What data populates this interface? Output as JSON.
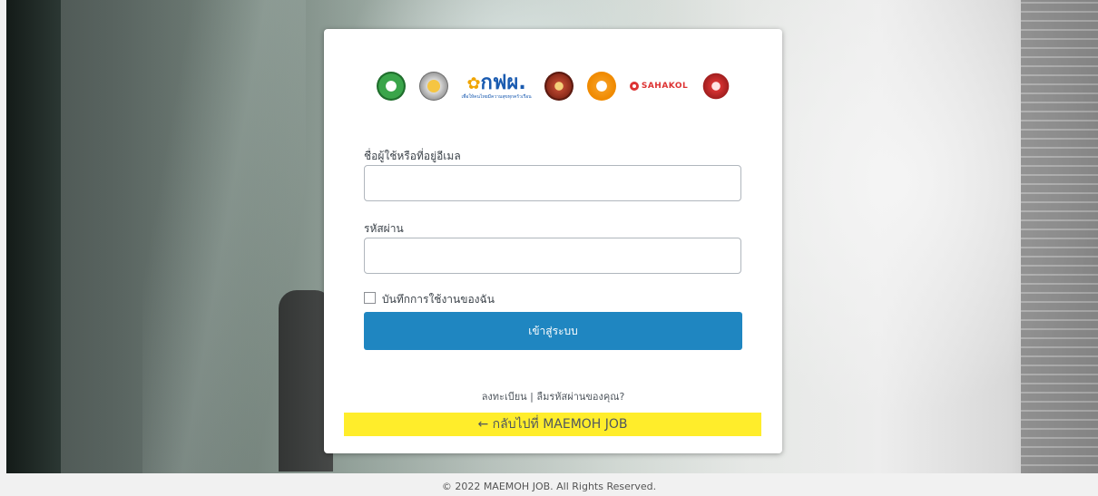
{
  "login": {
    "username_label": "ชื่อผู้ใช้หรือที่อยู่อีเมล",
    "username_value": "",
    "password_label": "รหัสผ่าน",
    "password_value": "",
    "remember_label": "บันทึกการใช้งานของฉัน",
    "submit_label": "เข้าสู่ระบบ",
    "register_link": "ลงทะเบียน",
    "separator": "|",
    "forgot_link": "ลืมรหัสผ่านของคุณ?",
    "back_link": "← กลับไปที่ MAEMOH JOB"
  },
  "logos": {
    "egat_text": "กฟผ.",
    "egat_subtext": "เพื่อให้คนไทยมีความสุขทุกครัวเรือน",
    "sahakol_text": "SAHAKOL"
  },
  "footer": {
    "copyright": "© 2022 MAEMOH JOB. All Rights Reserved."
  },
  "colors": {
    "button": "#1f86c1",
    "back_highlight": "#ffed2b"
  },
  "icons": [
    "eye-icon",
    "checkbox"
  ]
}
